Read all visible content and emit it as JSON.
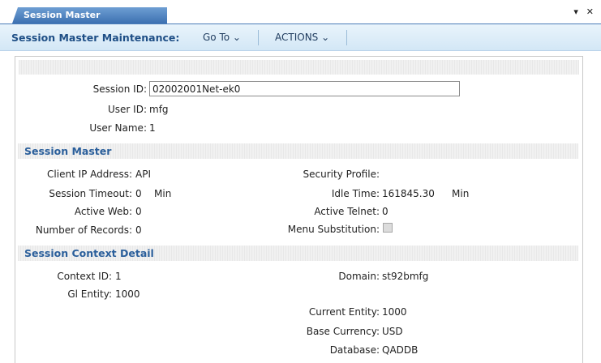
{
  "tab": {
    "label": "Session Master Maintenance",
    "controls": "▾ ✕"
  },
  "toolbar": {
    "title": "Session Master Maintenance:",
    "goto_label": "Go To ⌄",
    "actions_label": "ACTIONS ⌄"
  },
  "header_fields": {
    "session_id_label": "Session ID:",
    "session_id_value": "02002001Net-ek0",
    "user_id_label": "User ID:",
    "user_id_value": "mfg",
    "user_name_label": "User Name:",
    "user_name_value": "1"
  },
  "session_master": {
    "title": "Session Master",
    "client_ip_label": "Client IP Address:",
    "client_ip_value": "API",
    "security_profile_label": "Security Profile:",
    "security_profile_value": "",
    "session_timeout_label": "Session Timeout:",
    "session_timeout_value": "0",
    "session_timeout_unit": "Min",
    "idle_time_label": "Idle Time:",
    "idle_time_value": "161845.30",
    "idle_time_unit": "Min",
    "active_web_label": "Active Web:",
    "active_web_value": "0",
    "active_telnet_label": "Active Telnet:",
    "active_telnet_value": "0",
    "num_records_label": "Number of Records:",
    "num_records_value": "0",
    "menu_subst_label": "Menu Substitution:",
    "menu_subst_checked": false
  },
  "context_detail": {
    "title": "Session Context Detail",
    "context_id_label": "Context ID:",
    "context_id_value": "1",
    "domain_label": "Domain:",
    "domain_value": "st92bmfg",
    "gl_entity_label": "Gl Entity:",
    "gl_entity_value": "1000",
    "current_entity_label": "Current Entity:",
    "current_entity_value": "1000",
    "base_currency_label": "Base Currency:",
    "base_currency_value": "USD",
    "database_label": "Database:",
    "database_value": "QADDB"
  }
}
